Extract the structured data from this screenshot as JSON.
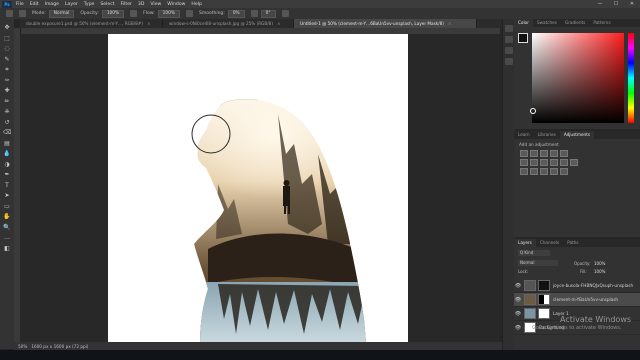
{
  "app": {
    "logo": "Ps"
  },
  "menu": [
    "File",
    "Edit",
    "Image",
    "Layer",
    "Type",
    "Select",
    "Filter",
    "3D",
    "View",
    "Window",
    "Help"
  ],
  "window_controls": [
    "—",
    "☐",
    "✕"
  ],
  "options_bar": {
    "mode_label": "Mode:",
    "mode_value": "Normal",
    "opacity_label": "Opacity:",
    "opacity_value": "100%",
    "flow_label": "Flow:",
    "flow_value": "100%",
    "smoothing_label": "Smoothing:",
    "smoothing_value": "0%",
    "angle_value": "0°"
  },
  "doc_tabs": [
    {
      "label": "double exposure1.psd @ 50% (element-m-Y…, RGB/8#)",
      "close": "×"
    },
    {
      "label": "window-s-0Ni0ce4l8-unsplash.jpg @ 25% (RGB/8)",
      "close": "×"
    },
    {
      "label": "Untitled-1 @ 50% (clement-m-Y…6BaUn5vv-unsplash, Layer Mask/8)",
      "close": "×"
    }
  ],
  "tools": [
    "move-icon",
    "marquee-icon",
    "lasso-icon",
    "quick-select-icon",
    "crop-icon",
    "eyedropper-icon",
    "healing-icon",
    "brush-icon",
    "stamp-icon",
    "history-brush-icon",
    "eraser-icon",
    "gradient-icon",
    "blur-icon",
    "dodge-icon",
    "pen-icon",
    "type-icon",
    "path-select-icon",
    "shape-icon",
    "hand-icon",
    "zoom-icon",
    "more-icon",
    "colors-icon"
  ],
  "tool_glyphs": [
    "✥",
    "⬚",
    "◌",
    "✎",
    "⌗",
    "✑",
    "✚",
    "✏",
    "⎈",
    "↺",
    "⌫",
    "▤",
    "💧",
    "◑",
    "✒",
    "T",
    "➤",
    "▭",
    "✋",
    "🔍",
    "…",
    "◧"
  ],
  "statusbar": {
    "zoom": "50%",
    "info": "1600 px x 1600 px (72 ppi)"
  },
  "color_panel": {
    "tabs": [
      "Color",
      "Swatches",
      "Gradients",
      "Patterns"
    ],
    "active": 0,
    "hue_color": "#ff1e1e"
  },
  "adjustments": {
    "tabs": [
      "Learn",
      "Libraries",
      "Adjustments"
    ],
    "active": 2,
    "add_label": "Add an adjustment"
  },
  "layers_panel": {
    "tabs": [
      "Layers",
      "Channels",
      "Paths"
    ],
    "active": 0,
    "kind_label": "Q Kind",
    "blend_mode": "Normal",
    "opacity_label": "Opacity:",
    "opacity_value": "100%",
    "lock_label": "Lock:",
    "fill_label": "Fill:",
    "fill_value": "100%",
    "layers": [
      {
        "name": "joyce-busola-FHBNQJxQsuph-unsplash",
        "visible": true
      },
      {
        "name": "clement-m-YBaUn5vv-unsplash",
        "visible": true,
        "selected": true
      },
      {
        "name": "Layer 1",
        "visible": true
      },
      {
        "name": "Background",
        "visible": true
      }
    ]
  },
  "watermark": {
    "line1": "Activate Windows",
    "line2": "Go to Settings to activate Windows."
  }
}
